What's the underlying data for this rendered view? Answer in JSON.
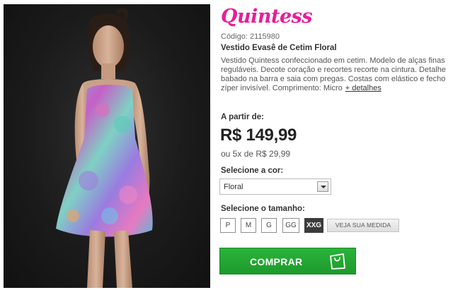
{
  "brand": {
    "name": "Quintess",
    "color": "#e61e9b"
  },
  "product": {
    "code": "Código: 2115980",
    "name": "Vestido Evasê de Cetim Floral",
    "description": "Vestido Quintess confeccionado em cetim. Modelo de alças finas reguláveis. Decote coração e recortes recorte na cintura. Detalhe babado na barra e saia com pregas. Costas com elástico e fecho zíper invisível. Comprimento: Micro",
    "more_link": "+ detalhes",
    "photo_alt_icon": "model-photo"
  },
  "pricing": {
    "from_label": "A partir de:",
    "price": "R$ 149,99",
    "installments": "ou 5x de R$ 29,99"
  },
  "color": {
    "label": "Selecione a cor:",
    "selected": "Floral"
  },
  "size": {
    "label": "Selecione o tamanho:",
    "options": [
      "P",
      "M",
      "G",
      "GG",
      "XXG"
    ],
    "selected": "XXG",
    "measure_button": "VEJA SUA MEDIDA"
  },
  "buy": {
    "label": "COMPRAR",
    "color": "#22a833",
    "icon": "shopping-bag-icon"
  }
}
